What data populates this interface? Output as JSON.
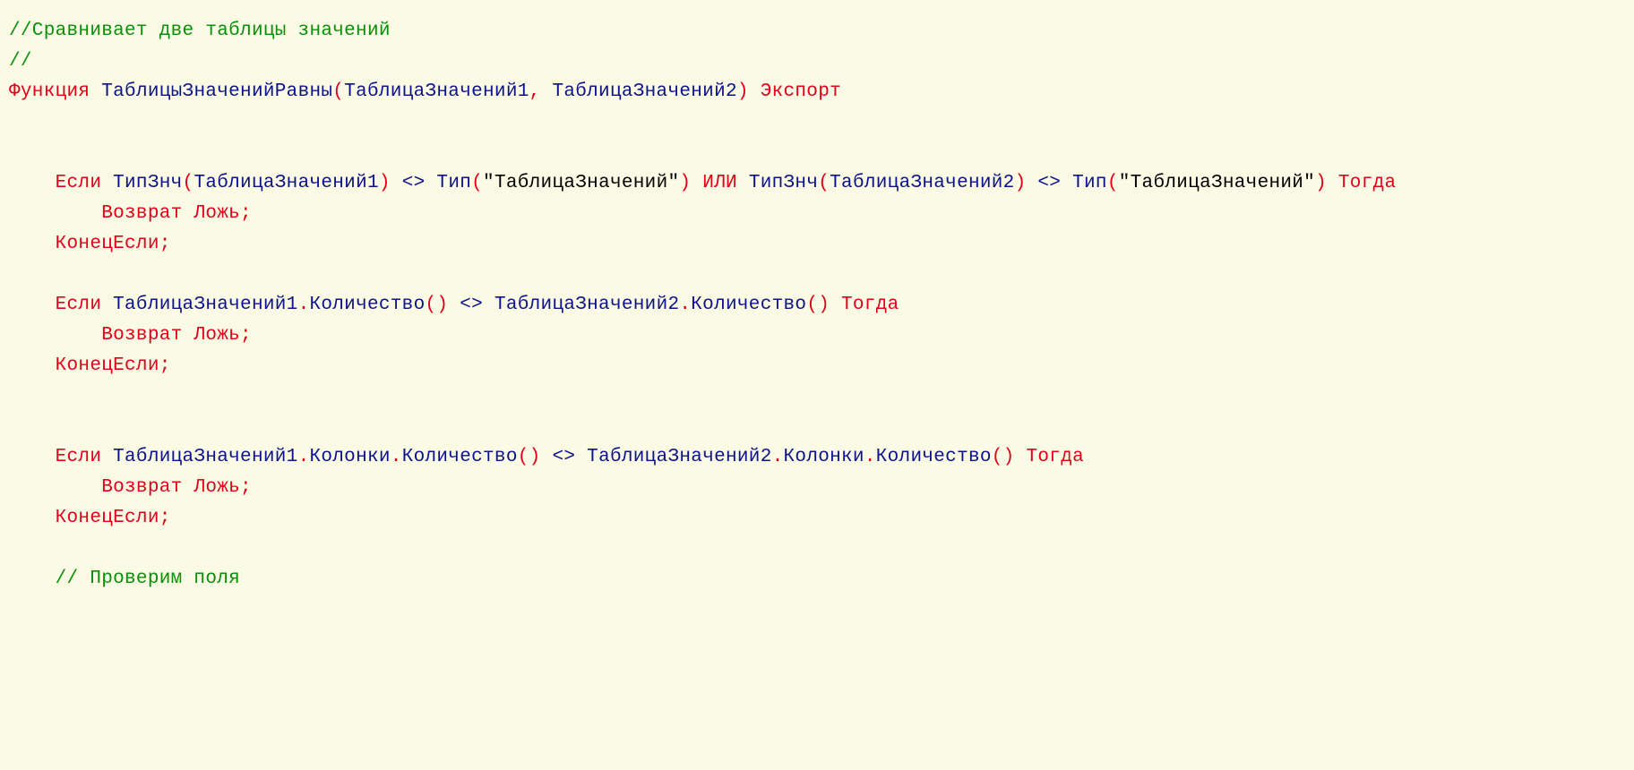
{
  "lines": [
    [
      {
        "cls": "c-comment",
        "t": "//Сравнивает две таблицы значений"
      }
    ],
    [
      {
        "cls": "c-comment",
        "t": "//"
      }
    ],
    [
      {
        "cls": "c-keyword",
        "t": "Функция"
      },
      {
        "cls": "",
        "t": " "
      },
      {
        "cls": "c-ident",
        "t": "ТаблицыЗначенийРавны"
      },
      {
        "cls": "c-punct",
        "t": "("
      },
      {
        "cls": "c-ident",
        "t": "ТаблицаЗначений1"
      },
      {
        "cls": "c-punct",
        "t": ","
      },
      {
        "cls": "",
        "t": " "
      },
      {
        "cls": "c-ident",
        "t": "ТаблицаЗначений2"
      },
      {
        "cls": "c-punct",
        "t": ")"
      },
      {
        "cls": "",
        "t": " "
      },
      {
        "cls": "c-keyword",
        "t": "Экспорт"
      }
    ],
    [
      {
        "cls": "",
        "t": ""
      }
    ],
    [
      {
        "cls": "",
        "t": ""
      }
    ],
    [
      {
        "cls": "",
        "t": "    "
      },
      {
        "cls": "c-keyword",
        "t": "Если"
      },
      {
        "cls": "",
        "t": " "
      },
      {
        "cls": "c-ident",
        "t": "ТипЗнч"
      },
      {
        "cls": "c-punct",
        "t": "("
      },
      {
        "cls": "c-ident",
        "t": "ТаблицаЗначений1"
      },
      {
        "cls": "c-punct",
        "t": ")"
      },
      {
        "cls": "",
        "t": " "
      },
      {
        "cls": "c-ident",
        "t": "<>"
      },
      {
        "cls": "",
        "t": " "
      },
      {
        "cls": "c-ident",
        "t": "Тип"
      },
      {
        "cls": "c-punct",
        "t": "("
      },
      {
        "cls": "c-string",
        "t": "\"ТаблицаЗначений\""
      },
      {
        "cls": "c-punct",
        "t": ")"
      },
      {
        "cls": "",
        "t": " "
      },
      {
        "cls": "c-keyword",
        "t": "ИЛИ"
      },
      {
        "cls": "",
        "t": " "
      },
      {
        "cls": "c-ident",
        "t": "ТипЗнч"
      },
      {
        "cls": "c-punct",
        "t": "("
      },
      {
        "cls": "c-ident",
        "t": "ТаблицаЗначений2"
      },
      {
        "cls": "c-punct",
        "t": ")"
      },
      {
        "cls": "",
        "t": " "
      },
      {
        "cls": "c-ident",
        "t": "<>"
      },
      {
        "cls": "",
        "t": " "
      },
      {
        "cls": "c-ident",
        "t": "Тип"
      },
      {
        "cls": "c-punct",
        "t": "("
      },
      {
        "cls": "c-string",
        "t": "\"ТаблицаЗначений\""
      },
      {
        "cls": "c-punct",
        "t": ")"
      },
      {
        "cls": "",
        "t": " "
      },
      {
        "cls": "c-keyword",
        "t": "Тогда"
      }
    ],
    [
      {
        "cls": "",
        "t": "        "
      },
      {
        "cls": "c-keyword",
        "t": "Возврат Ложь;"
      }
    ],
    [
      {
        "cls": "",
        "t": "    "
      },
      {
        "cls": "c-keyword",
        "t": "КонецЕсли;"
      }
    ],
    [
      {
        "cls": "",
        "t": ""
      }
    ],
    [
      {
        "cls": "",
        "t": "    "
      },
      {
        "cls": "c-keyword",
        "t": "Если"
      },
      {
        "cls": "",
        "t": " "
      },
      {
        "cls": "c-ident",
        "t": "ТаблицаЗначений1"
      },
      {
        "cls": "c-punct",
        "t": "."
      },
      {
        "cls": "c-ident",
        "t": "Количество"
      },
      {
        "cls": "c-punct",
        "t": "()"
      },
      {
        "cls": "",
        "t": " "
      },
      {
        "cls": "c-ident",
        "t": "<>"
      },
      {
        "cls": "",
        "t": " "
      },
      {
        "cls": "c-ident",
        "t": "ТаблицаЗначений2"
      },
      {
        "cls": "c-punct",
        "t": "."
      },
      {
        "cls": "c-ident",
        "t": "Количество"
      },
      {
        "cls": "c-punct",
        "t": "()"
      },
      {
        "cls": "",
        "t": " "
      },
      {
        "cls": "c-keyword",
        "t": "Тогда"
      }
    ],
    [
      {
        "cls": "",
        "t": "        "
      },
      {
        "cls": "c-keyword",
        "t": "Возврат Ложь;"
      }
    ],
    [
      {
        "cls": "",
        "t": "    "
      },
      {
        "cls": "c-keyword",
        "t": "КонецЕсли;"
      }
    ],
    [
      {
        "cls": "",
        "t": ""
      }
    ],
    [
      {
        "cls": "",
        "t": ""
      }
    ],
    [
      {
        "cls": "",
        "t": "    "
      },
      {
        "cls": "c-keyword",
        "t": "Если"
      },
      {
        "cls": "",
        "t": " "
      },
      {
        "cls": "c-ident",
        "t": "ТаблицаЗначений1"
      },
      {
        "cls": "c-punct",
        "t": "."
      },
      {
        "cls": "c-ident",
        "t": "Колонки"
      },
      {
        "cls": "c-punct",
        "t": "."
      },
      {
        "cls": "c-ident",
        "t": "Количество"
      },
      {
        "cls": "c-punct",
        "t": "()"
      },
      {
        "cls": "",
        "t": " "
      },
      {
        "cls": "c-ident",
        "t": "<>"
      },
      {
        "cls": "",
        "t": " "
      },
      {
        "cls": "c-ident",
        "t": "ТаблицаЗначений2"
      },
      {
        "cls": "c-punct",
        "t": "."
      },
      {
        "cls": "c-ident",
        "t": "Колонки"
      },
      {
        "cls": "c-punct",
        "t": "."
      },
      {
        "cls": "c-ident",
        "t": "Количество"
      },
      {
        "cls": "c-punct",
        "t": "()"
      },
      {
        "cls": "",
        "t": " "
      },
      {
        "cls": "c-keyword",
        "t": "Тогда"
      }
    ],
    [
      {
        "cls": "",
        "t": "        "
      },
      {
        "cls": "c-keyword",
        "t": "Возврат Ложь;"
      }
    ],
    [
      {
        "cls": "",
        "t": "    "
      },
      {
        "cls": "c-keyword",
        "t": "КонецЕсли;"
      }
    ],
    [
      {
        "cls": "",
        "t": ""
      }
    ],
    [
      {
        "cls": "",
        "t": "    "
      },
      {
        "cls": "c-comment",
        "t": "// Проверим поля"
      }
    ]
  ]
}
